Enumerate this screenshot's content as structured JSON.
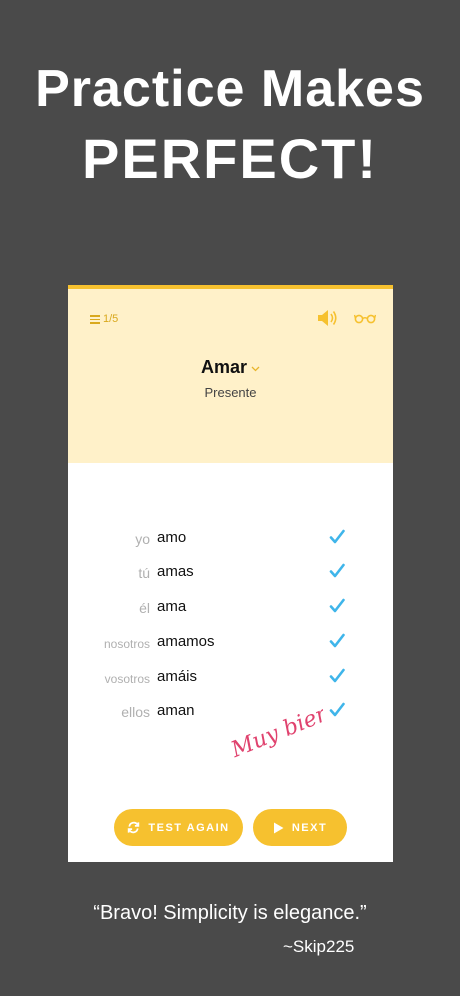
{
  "headline": {
    "line1": "Practice Makes",
    "line2": "PERFECT!"
  },
  "app": {
    "counter": "1/5",
    "verb": "Amar",
    "tense": "Presente",
    "conjugations": [
      {
        "pronoun": "yo",
        "form": "amo",
        "correct": true
      },
      {
        "pronoun": "tú",
        "form": "amas",
        "correct": true
      },
      {
        "pronoun": "él",
        "form": "ama",
        "correct": true
      },
      {
        "pronoun": "nosotros",
        "form": "amamos",
        "correct": true
      },
      {
        "pronoun": "vosotros",
        "form": "amáis",
        "correct": true
      },
      {
        "pronoun": "ellos",
        "form": "aman",
        "correct": true
      }
    ],
    "signature": "Muy bien",
    "buttons": {
      "test_again": "TEST AGAIN",
      "next": "NEXT"
    },
    "icons": {
      "menu": "menu-icon",
      "speaker": "speaker-icon",
      "glasses": "glasses-icon",
      "chevron": "chevron-down-icon",
      "check": "check-icon",
      "refresh": "refresh-icon",
      "play": "play-icon"
    },
    "colors": {
      "accent": "#f6c12f",
      "header_bg": "#fff1c9",
      "check": "#3fb5ea",
      "signature": "#e0426e"
    }
  },
  "testimonial": {
    "quote": "“Bravo! Simplicity is elegance.”",
    "author": "~Skip225"
  }
}
